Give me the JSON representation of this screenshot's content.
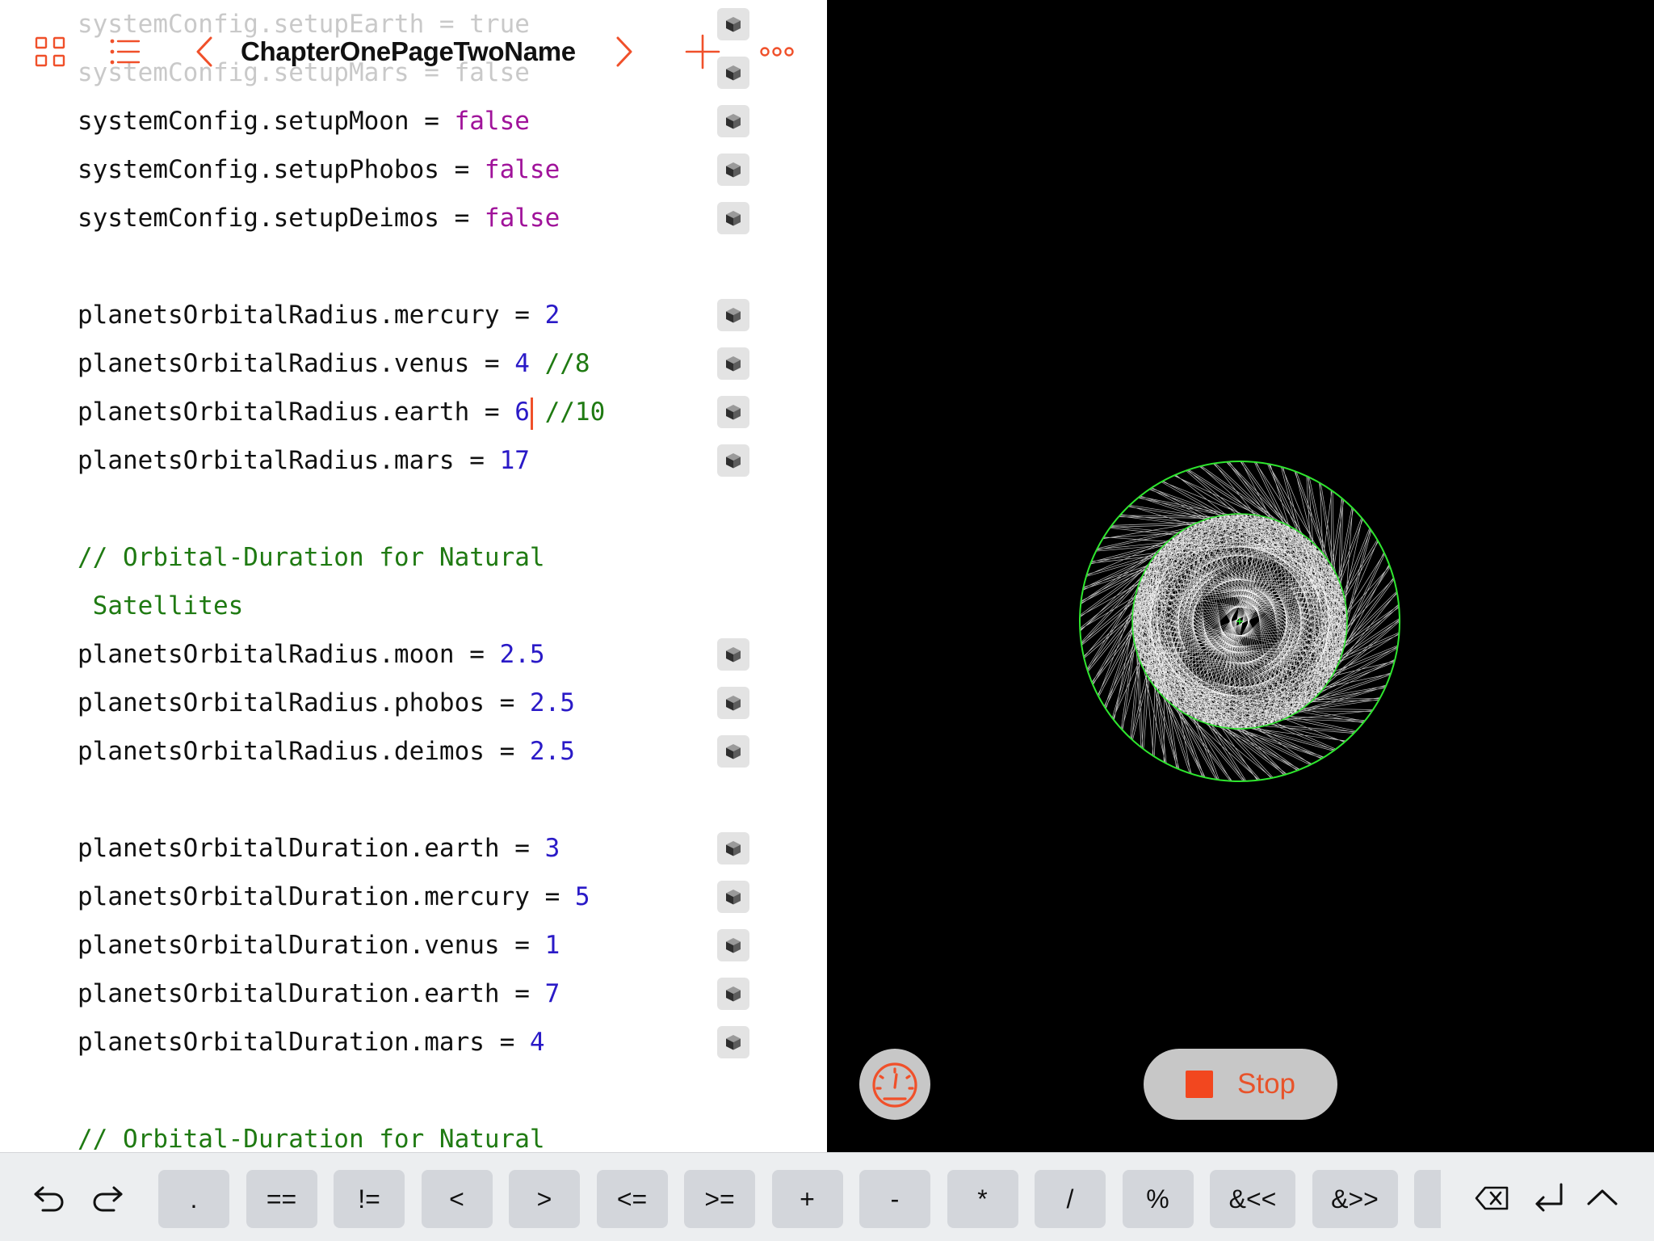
{
  "navbar": {
    "title": "ChapterOnePageTwoName",
    "icons": [
      "grid-icon",
      "list-icon",
      "chevron-left-icon",
      "chevron-right-icon",
      "plus-icon",
      "more-icon"
    ]
  },
  "accent_color": "#f0502a",
  "code_lines": [
    [
      {
        "t": "systemConfig.setupEarth = ",
        "c": ""
      },
      {
        "t": "true",
        "c": "kw"
      }
    ],
    [
      {
        "t": "systemConfig.setupMars = ",
        "c": ""
      },
      {
        "t": "false",
        "c": "kw"
      }
    ],
    [
      {
        "t": "systemConfig.setupMoon = ",
        "c": ""
      },
      {
        "t": "false",
        "c": "kw"
      }
    ],
    [
      {
        "t": "systemConfig.setupPhobos = ",
        "c": ""
      },
      {
        "t": "false",
        "c": "kw"
      }
    ],
    [
      {
        "t": "systemConfig.setupDeimos = ",
        "c": ""
      },
      {
        "t": "false",
        "c": "kw"
      }
    ],
    [],
    [
      {
        "t": "planetsOrbitalRadius.mercury = ",
        "c": ""
      },
      {
        "t": "2",
        "c": "num"
      }
    ],
    [
      {
        "t": "planetsOrbitalRadius.venus = ",
        "c": ""
      },
      {
        "t": "4",
        "c": "num"
      },
      {
        "t": " //8",
        "c": "cm"
      }
    ],
    [
      {
        "t": "planetsOrbitalRadius.earth = ",
        "c": ""
      },
      {
        "t": "6",
        "c": "num"
      },
      {
        "t": "",
        "c": "caret"
      },
      {
        "t": " //10",
        "c": "cm"
      }
    ],
    [
      {
        "t": "planetsOrbitalRadius.mars = ",
        "c": ""
      },
      {
        "t": "17",
        "c": "num"
      }
    ],
    [],
    [
      {
        "t": "// Orbital-Duration for Natural",
        "c": "cm"
      }
    ],
    [
      {
        "t": " Satellites",
        "c": "cm"
      }
    ],
    [
      {
        "t": "planetsOrbitalRadius.moon = ",
        "c": ""
      },
      {
        "t": "2.5",
        "c": "num"
      }
    ],
    [
      {
        "t": "planetsOrbitalRadius.phobos = ",
        "c": ""
      },
      {
        "t": "2.5",
        "c": "num"
      }
    ],
    [
      {
        "t": "planetsOrbitalRadius.deimos = ",
        "c": ""
      },
      {
        "t": "2.5",
        "c": "num"
      }
    ],
    [],
    [
      {
        "t": "planetsOrbitalDuration.earth = ",
        "c": ""
      },
      {
        "t": "3",
        "c": "num"
      }
    ],
    [
      {
        "t": "planetsOrbitalDuration.mercury = ",
        "c": ""
      },
      {
        "t": "5",
        "c": "num"
      }
    ],
    [
      {
        "t": "planetsOrbitalDuration.venus = ",
        "c": ""
      },
      {
        "t": "1",
        "c": "num"
      }
    ],
    [
      {
        "t": "planetsOrbitalDuration.earth = ",
        "c": ""
      },
      {
        "t": "7",
        "c": "num"
      }
    ],
    [
      {
        "t": "planetsOrbitalDuration.mars = ",
        "c": ""
      },
      {
        "t": "4",
        "c": "num"
      }
    ],
    [],
    [
      {
        "t": "// Orbital-Duration for Natural",
        "c": "cm"
      }
    ]
  ],
  "faded_lines": [
    0,
    1
  ],
  "cube_lines": [
    0,
    1,
    2,
    3,
    4,
    6,
    7,
    8,
    9,
    13,
    14,
    15,
    17,
    18,
    19,
    20,
    21
  ],
  "liveview": {
    "stop_label": "Stop",
    "icons": [
      "speedometer-icon",
      "stop-icon"
    ]
  },
  "shortcut_bar": {
    "left_icons": [
      "undo-icon",
      "redo-icon"
    ],
    "keys": [
      ".",
      "==",
      "!=",
      "<",
      ">",
      "<=",
      ">=",
      "+",
      "-",
      "*",
      "/",
      "%",
      "&<<",
      "&>>",
      "&"
    ],
    "right_icons": [
      "delete-icon",
      "return-icon",
      "hide-keyboard-icon"
    ]
  }
}
